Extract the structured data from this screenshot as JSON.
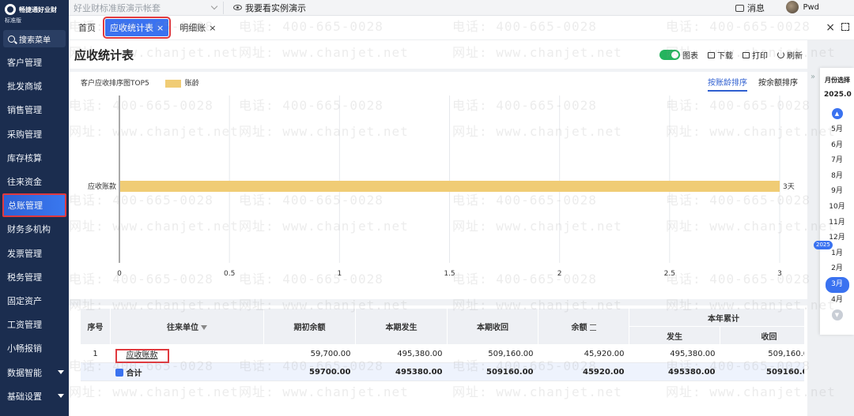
{
  "app": {
    "brand_name": "畅捷通好业财",
    "brand_edition": "标准版",
    "search_menu": "搜索菜单"
  },
  "sidebar": {
    "items": [
      {
        "label": "客户管理"
      },
      {
        "label": "批发商城"
      },
      {
        "label": "销售管理"
      },
      {
        "label": "采购管理"
      },
      {
        "label": "库存核算"
      },
      {
        "label": "往来资金"
      },
      {
        "label": "总账管理",
        "active": true
      },
      {
        "label": "财务多机构"
      },
      {
        "label": "发票管理"
      },
      {
        "label": "税务管理"
      },
      {
        "label": "固定资产"
      },
      {
        "label": "工资管理"
      },
      {
        "label": "小畅报销"
      },
      {
        "label": "数据智能",
        "expandable": true
      },
      {
        "label": "基础设置",
        "expandable": true
      }
    ]
  },
  "topbar": {
    "company": "好业财标准版演示帐套",
    "demo_link": "我要看实例演示",
    "messages": "消息",
    "user": "Pwd"
  },
  "tabs": [
    {
      "label": "首页"
    },
    {
      "label": "应收统计表",
      "active": true
    },
    {
      "label": "明细账"
    }
  ],
  "page": {
    "title": "应收统计表",
    "toolbar": {
      "chart_toggle": "图表",
      "download": "下载",
      "print": "打印",
      "refresh": "刷新"
    },
    "chart_caption": "客户应收排序图TOP5",
    "legend_label": "账龄",
    "sort_tabs": [
      {
        "label": "按账龄排序",
        "active": true
      },
      {
        "label": "按余额排序"
      }
    ]
  },
  "chart_data": {
    "type": "bar",
    "orientation": "horizontal",
    "categories": [
      "应收账款"
    ],
    "series": [
      {
        "name": "账龄",
        "values": [
          3
        ]
      }
    ],
    "data_labels": [
      "3天"
    ],
    "xlim": [
      0,
      3
    ],
    "xticks": [
      "0",
      "0.5",
      "1",
      "1.5",
      "2",
      "2.5",
      "3"
    ],
    "grid": true,
    "legend": "top-left",
    "bar_color": "#f0cc75"
  },
  "table": {
    "headers": {
      "index": "序号",
      "party": "往来单位",
      "opening": "期初余额",
      "period_occur": "本期发生",
      "period_recv": "本期收回",
      "balance": "余额",
      "ytd": "本年累计",
      "ytd_occur": "发生",
      "ytd_recv": "收回"
    },
    "rows": [
      {
        "index": "1",
        "party": "应收账款",
        "opening": "59,700.00",
        "period_occur": "495,380.00",
        "period_recv": "509,160.00",
        "balance": "45,920.00",
        "ytd_occur": "495,380.00",
        "ytd_recv": "509,160.00"
      }
    ],
    "total": {
      "label": "合计",
      "opening": "59700.00",
      "period_occur": "495380.00",
      "period_recv": "509160.00",
      "balance": "45920.00",
      "ytd_occur": "495380.00",
      "ytd_recv": "509160.00"
    }
  },
  "month_panel": {
    "title": "月份选择",
    "year_value": "2025.0",
    "year_badge": "2025",
    "months": [
      "5月",
      "6月",
      "7月",
      "8月",
      "9月",
      "10月",
      "11月",
      "12月",
      "1月",
      "2月",
      "3月",
      "4月"
    ],
    "active_month": "3月"
  },
  "watermark": {
    "phone": "电话: 400-665-0028",
    "site": "网址: www.chanjet.net"
  }
}
